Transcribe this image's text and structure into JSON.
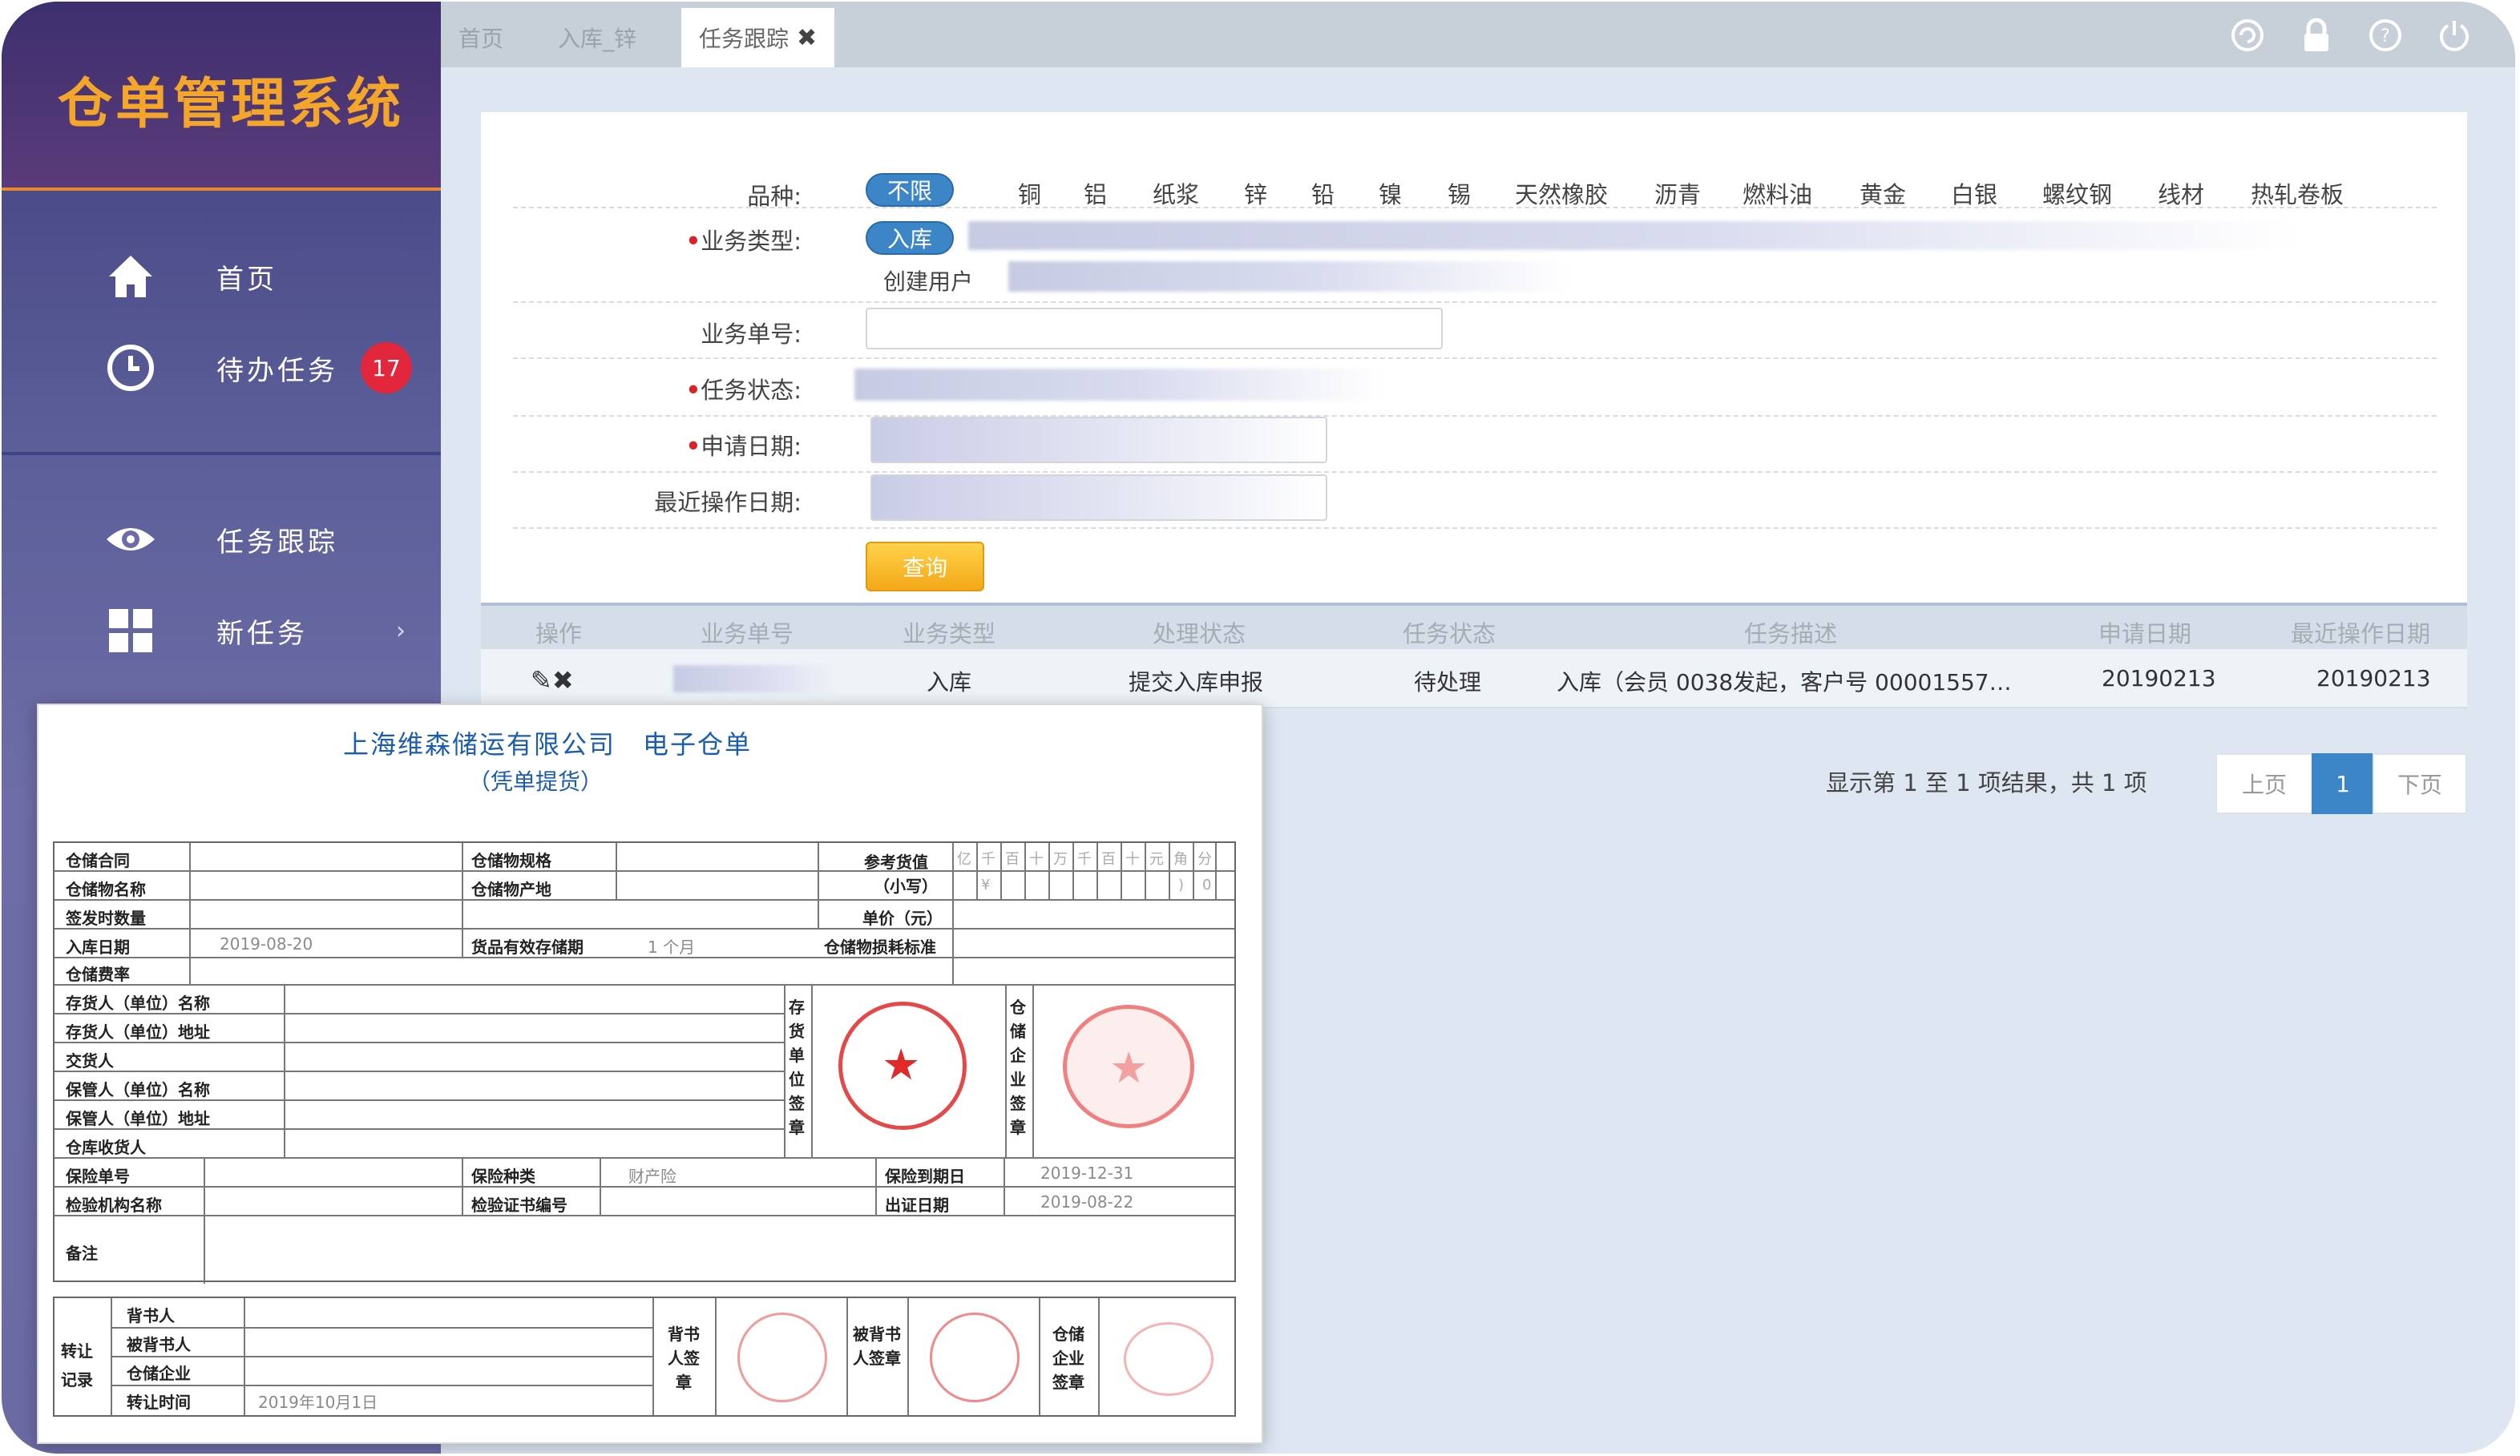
{
  "app": {
    "title": "仓单管理系统"
  },
  "sidebar": {
    "items": [
      {
        "label": "首页",
        "icon": "home-icon"
      },
      {
        "label": "待办任务",
        "icon": "clock-icon",
        "badge": "17"
      },
      {
        "label": "任务跟踪",
        "icon": "eye-icon"
      },
      {
        "label": "新任务",
        "icon": "grid-icon",
        "chevron": "›"
      }
    ]
  },
  "tabs": [
    {
      "label": "首页"
    },
    {
      "label": "入库_锌"
    },
    {
      "label": "任务跟踪",
      "close": "✖"
    }
  ],
  "form": {
    "variety_label": "品种:",
    "varieties": [
      "不限",
      "铜",
      "铝",
      "纸浆",
      "锌",
      "铅",
      "镍",
      "锡",
      "天然橡胶",
      "沥青",
      "燃料油",
      "黄金",
      "白银",
      "螺纹钢",
      "线材",
      "热轧卷板"
    ],
    "biz_type_label": "业务类型:",
    "biz_type_value": "入库",
    "creator_label": "创建用户",
    "biz_no_label": "业务单号:",
    "task_status_label": "任务状态:",
    "apply_date_label": "申请日期:",
    "last_op_label": "最近操作日期:",
    "query_button": "查询"
  },
  "table": {
    "headers": [
      "操作",
      "业务单号",
      "业务类型",
      "处理状态",
      "任务状态",
      "任务描述",
      "申请日期",
      "最近操作日期"
    ],
    "rows": [
      {
        "ops": "✎✖",
        "type": "入库",
        "process": "提交入库申报",
        "status": "待处理",
        "desc": "入库（会员 0038发起，客户号 00001557…",
        "apply": "20190213",
        "last": "20190213"
      }
    ]
  },
  "pager": {
    "info": "显示第 1 至 1 项结果，共 1 项",
    "prev": "上页",
    "page": "1",
    "next": "下页"
  },
  "certificate": {
    "company": "上海维森储运有限公司　电子仓单",
    "subtitle": "（凭单提货）",
    "labels": {
      "contract": "仓储合同",
      "spec": "仓储物规格",
      "ref_value": "参考货值",
      "ref_value2": "（小写）",
      "name": "仓储物名称",
      "origin": "仓储物产地",
      "qty": "签发时数量",
      "unit_price": "单价（元）",
      "in_date": "入库日期",
      "valid_period": "货品有效存储期",
      "loss_std": "仓储物损耗标准",
      "fee_rate": "仓储费率",
      "depositor_name": "存货人（单位）名称",
      "depositor_addr": "存货人（单位）地址",
      "deliverer": "交货人",
      "keeper_name": "保管人（单位）名称",
      "keeper_addr": "保管人（单位）地址",
      "receiver": "仓库收货人",
      "depositor_seal": "存货单位签章",
      "warehouse_seal": "仓储企业签章",
      "ins_no": "保险单号",
      "ins_type": "保险种类",
      "ins_expire": "保险到期日",
      "inspect_org": "检验机构名称",
      "inspect_no": "检验证书编号",
      "issue_date": "出证日期",
      "remark": "备注",
      "transfer": "转让记录",
      "endorser": "背书人",
      "endorsee": "被背书人",
      "wh_company": "仓储企业",
      "transfer_time": "转让时间",
      "endorser_seal": "背书人签章",
      "endorsee_seal": "被背书人签章",
      "wh_seal": "仓储企业签章"
    },
    "values": {
      "in_date": "2019-08-20",
      "valid_period": "1 个月",
      "ins_type": "财产险",
      "ins_expire": "2019-12-31",
      "issue_date": "2019-08-22",
      "transfer_time": "2019年10月1日"
    },
    "digit_units": [
      "亿",
      "千",
      "百",
      "十",
      "万",
      "千",
      "百",
      "十",
      "元",
      "角",
      "分"
    ],
    "currency": "¥",
    "digits": [
      "",
      "",
      "",
      "",
      "",
      "",
      "",
      "",
      "",
      ")",
      "0"
    ]
  },
  "colors": {
    "accent": "#3c86c8",
    "logo": "#f4a62a",
    "badge": "#e2263b",
    "seal": "#e44848"
  }
}
